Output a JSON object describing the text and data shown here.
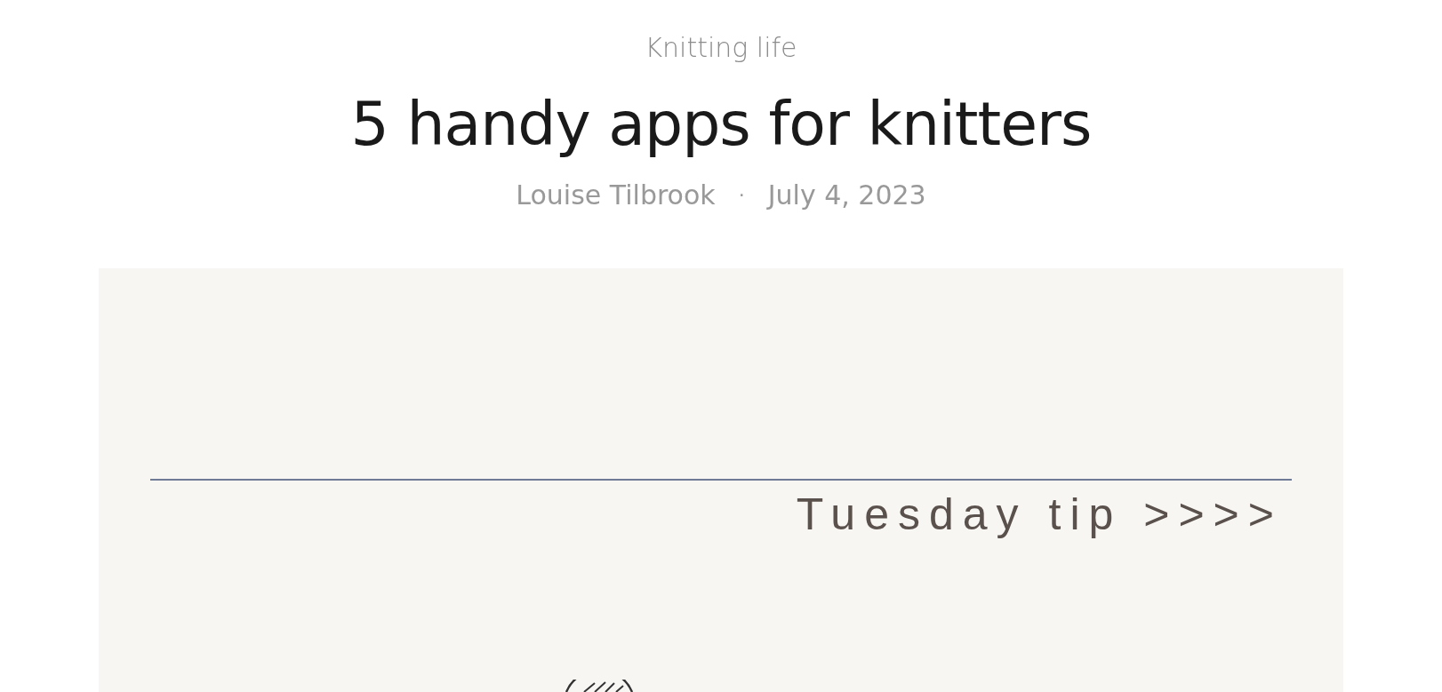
{
  "category": "Knitting life",
  "title": "5 handy apps for knitters",
  "meta": {
    "author": "Louise Tilbrook",
    "separator": "·",
    "date": "July 4, 2023"
  },
  "banner": {
    "tagline": "Tuesday tip >>>>"
  }
}
